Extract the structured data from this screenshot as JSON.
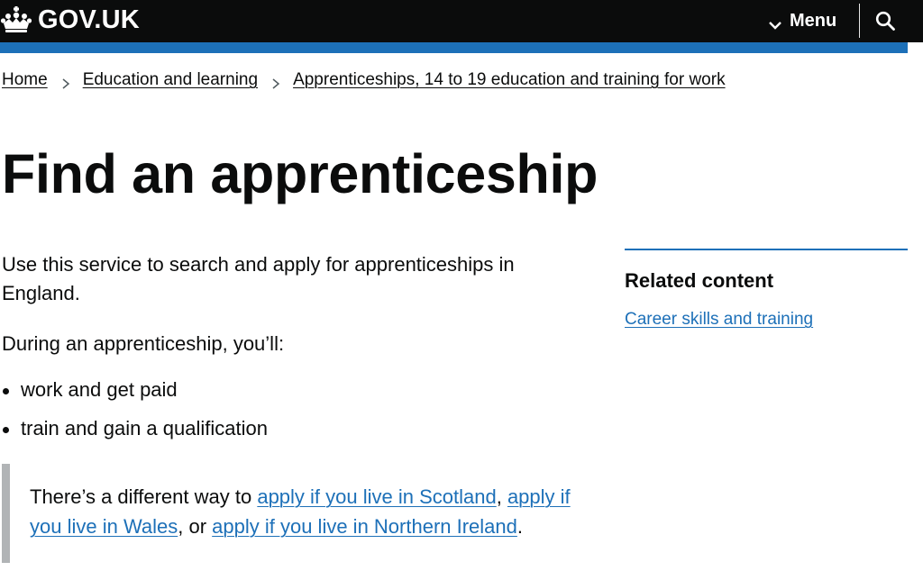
{
  "header": {
    "logo_text": "GOV.UK",
    "menu_label": "Menu",
    "icons": {
      "logo": "crown-icon",
      "menu": "chevron-down-icon",
      "search": "search-icon"
    }
  },
  "breadcrumbs": [
    {
      "label": "Home"
    },
    {
      "label": "Education and learning"
    },
    {
      "label": "Apprenticeships, 14 to 19 education and training for work"
    }
  ],
  "page": {
    "title": "Find an apprenticeship",
    "intro": "Use this service to search and apply for apprenticeships in England.",
    "during": "During an apprenticeship, you’ll:",
    "bullets": [
      "work and get paid",
      "train and gain a qualification"
    ],
    "inset": {
      "prefix": "There’s a different way to ",
      "link_scotland": "apply if you live in Scotland",
      "sep1": ", ",
      "link_wales": "apply if you live in Wales",
      "sep2": ", or ",
      "link_ni": "apply if you live in Northern Ireland",
      "suffix": "."
    }
  },
  "related": {
    "heading": "Related content",
    "links": [
      {
        "label": "Career skills and training"
      }
    ]
  },
  "colors": {
    "header_bg": "#0b0c0c",
    "brand_blue": "#1d70b8",
    "link": "#1d70b8",
    "inset_border": "#b1b4b6",
    "text": "#0b0c0c"
  }
}
